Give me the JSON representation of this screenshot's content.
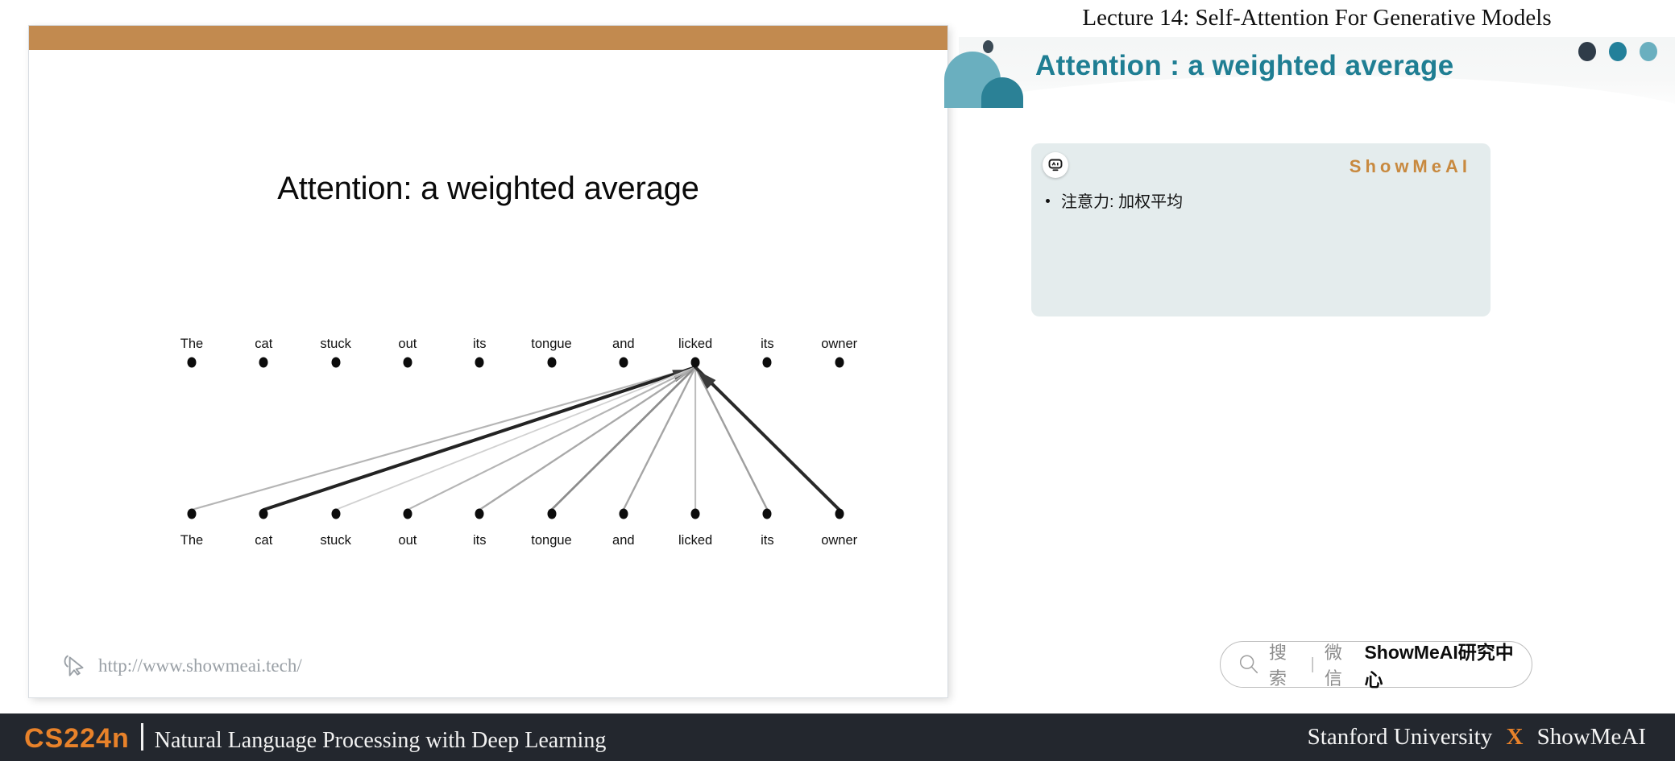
{
  "slide": {
    "title": "Attention: a weighted average",
    "topbar_color": "#c28a4f",
    "footer_url": "http://www.showmeai.tech/",
    "cursor_icon": "cursor-arrow-icon"
  },
  "diagram": {
    "type": "attention-weights",
    "top_row_words": [
      "The",
      "cat",
      "stuck",
      "out",
      "its",
      "tongue",
      "and",
      "licked",
      "its",
      "owner"
    ],
    "bottom_row_words": [
      "The",
      "cat",
      "stuck",
      "out",
      "its",
      "tongue",
      "and",
      "licked",
      "its",
      "owner"
    ],
    "target_word": "licked",
    "target_index": 7,
    "edge_weights": [
      0.22,
      0.95,
      0.08,
      0.22,
      0.28,
      0.42,
      0.3,
      0.18,
      0.33,
      0.92
    ]
  },
  "right_panel": {
    "lecture_title": "Lecture 14:  Self-Attention For Generative Models",
    "section_title": "Attention : a weighted average",
    "watermark": "ShowMeAI",
    "robot_icon": "robot-face-icon",
    "bullet_text": "注意力: 加权平均",
    "deco_dots": [
      "#2f3c49",
      "#23809a",
      "#6aafbf"
    ],
    "accent_teal": "#1f7e93",
    "card_background": "#e4eced"
  },
  "search": {
    "icon": "search-magnifier-icon",
    "label": "搜索",
    "separator": "|",
    "channel": "微信",
    "account": "ShowMeAI研究中心"
  },
  "bottom_bar": {
    "course_code": "CS224n",
    "course_name": "Natural Language Processing with Deep Learning",
    "affiliation_left": "Stanford University",
    "affiliation_x": "X",
    "affiliation_right": "ShowMeAI",
    "accent_orange": "#e8822a",
    "background": "#23272e"
  }
}
